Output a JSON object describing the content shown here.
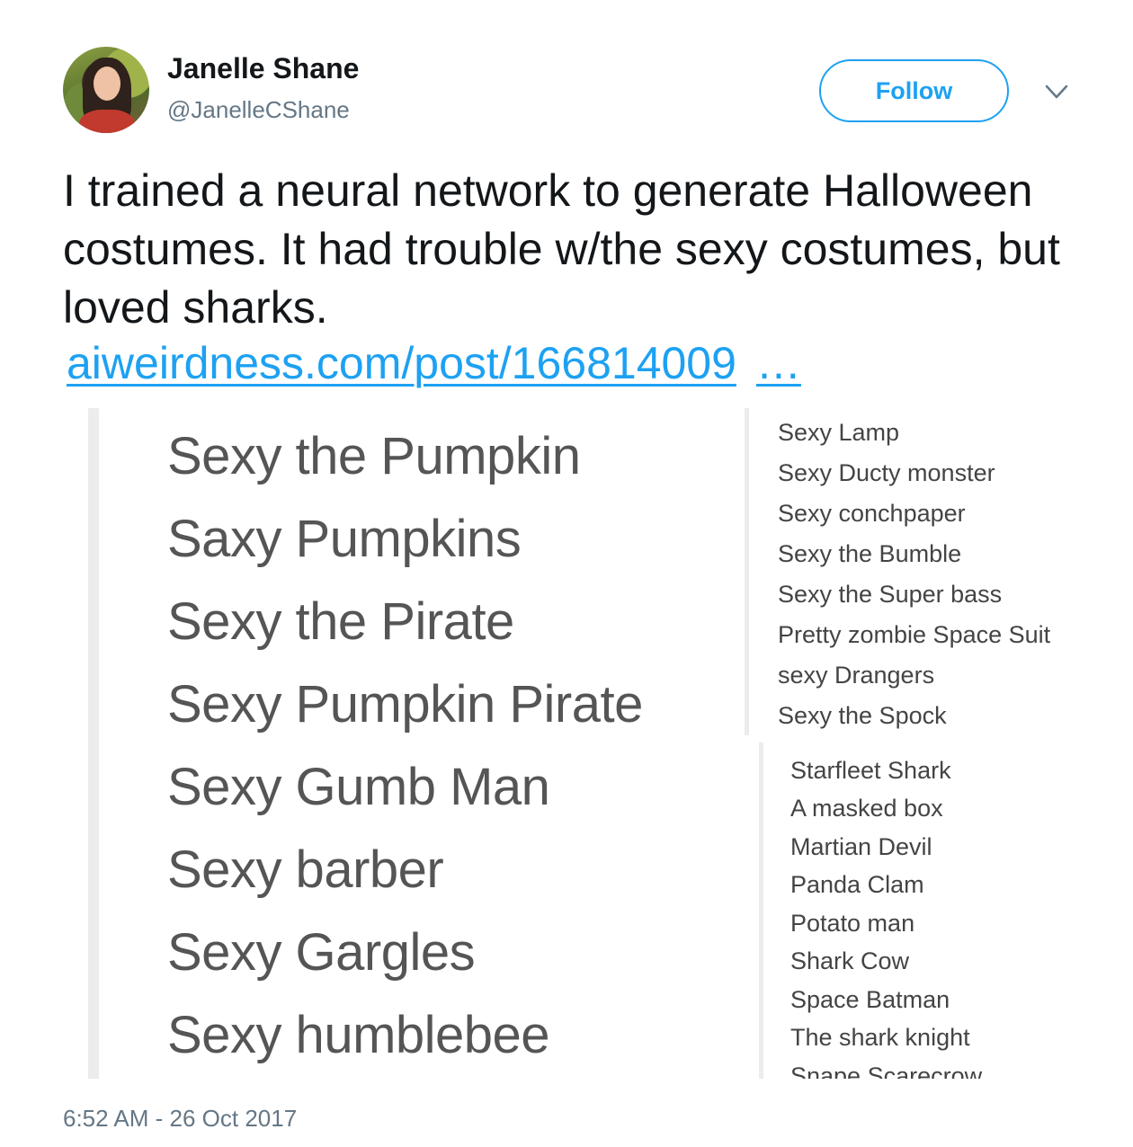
{
  "author": {
    "name": "Janelle Shane",
    "handle": "@JanelleCShane"
  },
  "actions": {
    "follow_label": "Follow"
  },
  "tweet": {
    "text": "I trained a neural network to generate Halloween costumes. It had trouble w/the sexy costumes, but loved sharks.",
    "link_text": "aiweirdness.com/post/166814009",
    "link_ellipsis": "…",
    "timestamp": "6:52 AM - 26 Oct 2017"
  },
  "media": {
    "left_list": [
      "Sexy the Pumpkin",
      "Saxy Pumpkins",
      "Sexy the Pirate",
      "Sexy Pumpkin Pirate",
      "Sexy Gumb Man",
      "Sexy barber",
      "Sexy Gargles",
      "Sexy humblebee"
    ],
    "right_top_list": [
      "Sexy Lamp",
      "Sexy Ducty monster",
      "Sexy conchpaper",
      "Sexy the Bumble",
      "Sexy the Super bass",
      "Pretty zombie Space Suit",
      "sexy Drangers",
      "Sexy the Spock"
    ],
    "right_bottom_list": [
      "Starfleet Shark",
      "A masked box",
      "Martian Devil",
      "Panda Clam",
      "Potato man",
      "Shark Cow",
      "Space Batman",
      "The shark knight",
      "Snape Scarecrow"
    ]
  },
  "icons": {
    "avatar": "profile-photo",
    "more": "chevron-down-icon"
  },
  "colors": {
    "accent": "#1da1f2",
    "text": "#14171a",
    "muted": "#657786"
  }
}
